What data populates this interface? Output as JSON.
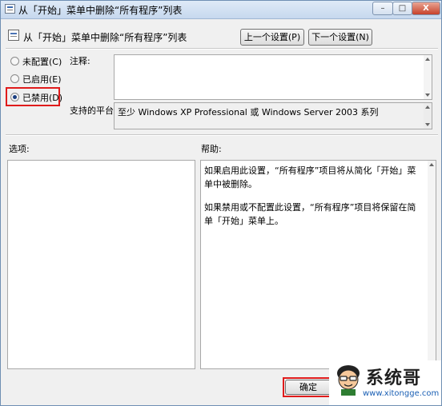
{
  "window": {
    "title": "从「开始」菜单中删除“所有程序”列表"
  },
  "titlebar_buttons": {
    "minimize": "–",
    "maximize": "□",
    "close": "X"
  },
  "header": {
    "setting_name": "从「开始」菜单中删除“所有程序”列表"
  },
  "nav": {
    "prev": "上一个设置(P)",
    "next": "下一个设置(N)"
  },
  "options": [
    {
      "label": "未配置(C)",
      "selected": false
    },
    {
      "label": "已启用(E)",
      "selected": false
    },
    {
      "label": "已禁用(D)",
      "selected": true
    }
  ],
  "comment": {
    "label": "注释:",
    "value": ""
  },
  "supported": {
    "label": "支持的平台:",
    "value": "至少 Windows XP Professional 或 Windows Server 2003 系列"
  },
  "options_section": {
    "label": "选项:"
  },
  "help_section": {
    "label": "帮助:",
    "paragraphs": [
      "如果启用此设置，“所有程序”项目将从简化「开始」菜单中被删除。",
      "如果禁用或不配置此设置，“所有程序”项目将保留在简单「开始」菜单上。"
    ]
  },
  "footer": {
    "ok": "确定"
  },
  "watermark": {
    "brand": "系统哥",
    "url": "www.xitongge.com"
  },
  "colors": {
    "highlight": "#e01b1b",
    "titlebar": "#c6d8ee"
  }
}
